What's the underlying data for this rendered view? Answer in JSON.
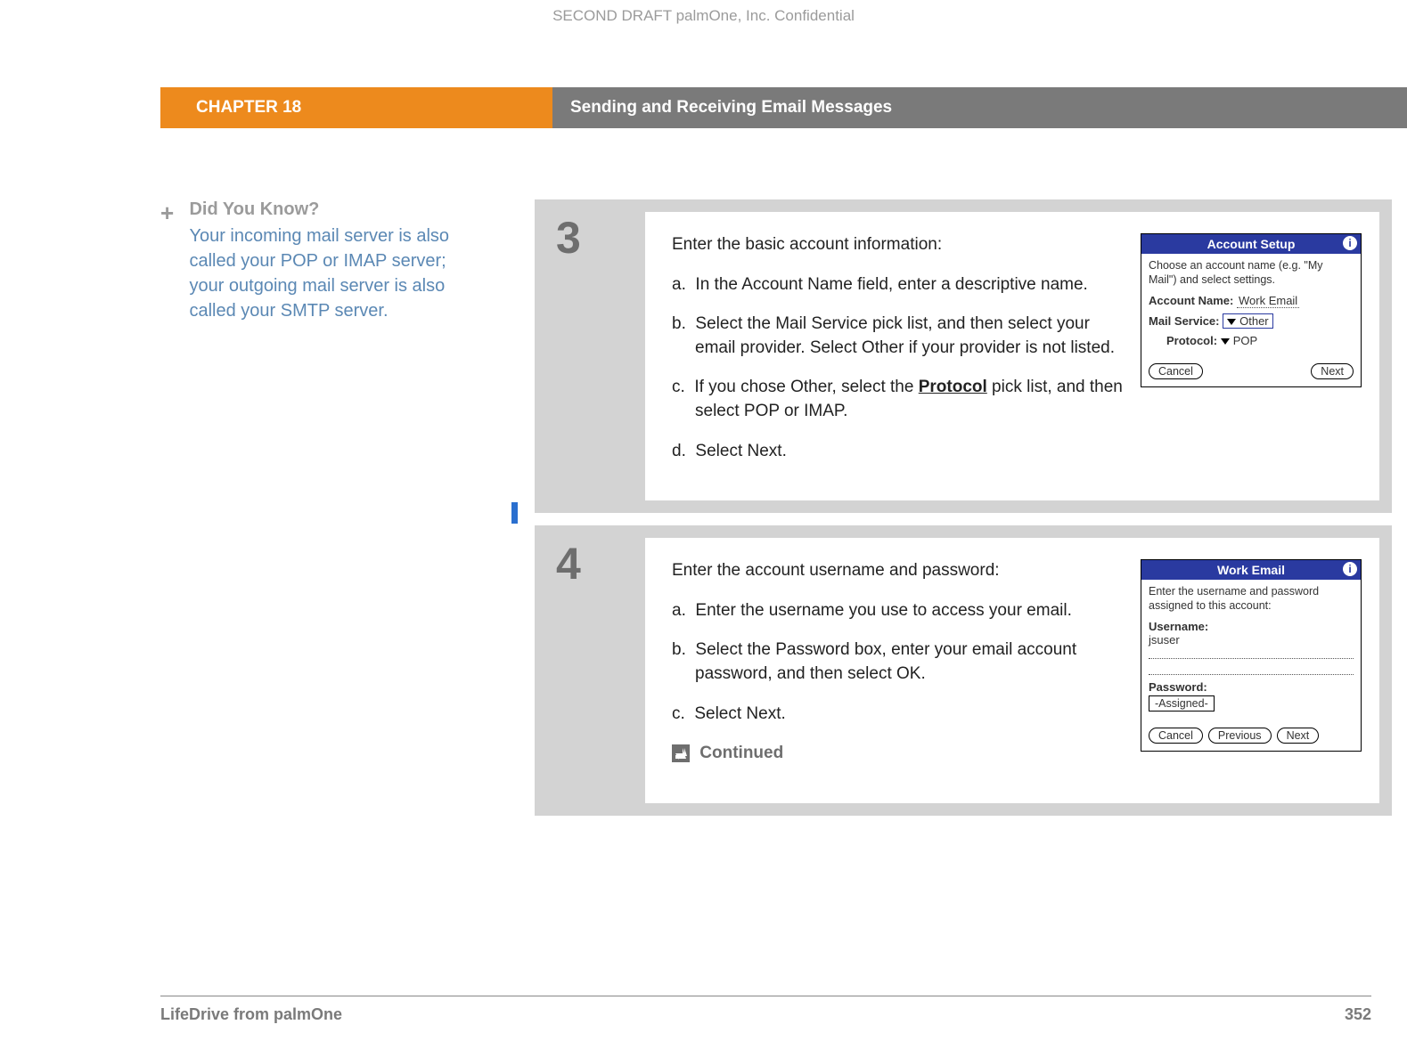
{
  "confidential": "SECOND DRAFT palmOne, Inc.  Confidential",
  "header": {
    "chapter": "CHAPTER 18",
    "title": "Sending and Receiving Email Messages"
  },
  "sidebar": {
    "dyk_title": "Did You Know?",
    "dyk_text": "Your incoming mail server is also called your POP or IMAP server; your outgoing mail server is also called your SMTP server."
  },
  "step3": {
    "num": "3",
    "intro": "Enter the basic account information:",
    "a_label": "a.",
    "a_text": "In the Account Name field, enter a descriptive name.",
    "b_label": "b.",
    "b_text": "Select the Mail Service pick list, and then select your email provider. Select Other if your provider is not listed.",
    "c_label": "c.",
    "c_text_pre": "If you chose Other, select the ",
    "c_link": "Protocol",
    "c_text_post": " pick list, and then select POP or IMAP.",
    "d_label": "d.",
    "d_text": "Select Next."
  },
  "palm1": {
    "title": "Account Setup",
    "instr": "Choose an account name (e.g. \"My Mail\") and select settings.",
    "acct_label": "Account Name:",
    "acct_val": "Work Email",
    "mail_label": "Mail Service:",
    "mail_val": "Other",
    "proto_label": "Protocol:",
    "proto_val": "POP",
    "cancel": "Cancel",
    "next": "Next"
  },
  "step4": {
    "num": "4",
    "intro": "Enter the account username and password:",
    "a_label": "a.",
    "a_text": "Enter the username you use to access your email.",
    "b_label": "b.",
    "b_text": "Select the Password box, enter your email account password, and then select OK.",
    "c_label": "c.",
    "c_text": "Select Next.",
    "continued": "Continued"
  },
  "palm2": {
    "title": "Work Email",
    "instr": "Enter the username and password assigned to this account:",
    "user_label": "Username:",
    "user_val": "jsuser",
    "pw_label": "Password:",
    "pw_val": "-Assigned-",
    "cancel": "Cancel",
    "prev": "Previous",
    "next": "Next"
  },
  "footer": {
    "product": "LifeDrive from palmOne",
    "page": "352"
  }
}
